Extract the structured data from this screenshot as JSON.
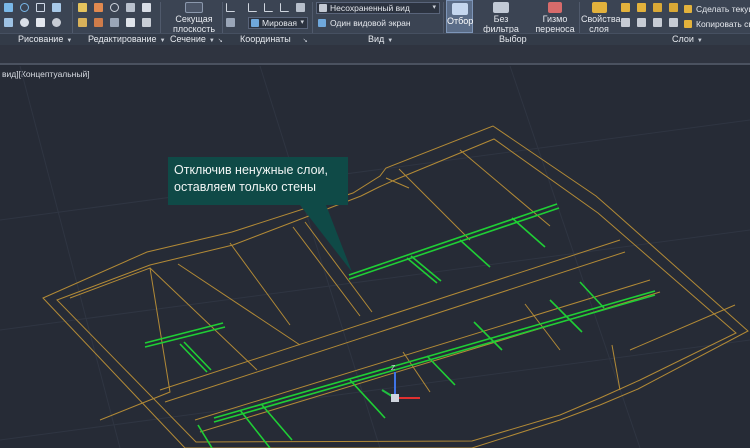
{
  "ribbon": {
    "groups": {
      "draw": "Рисование",
      "modify": "Редактирование",
      "section": "Сечение",
      "coordinates": "Координаты",
      "view": "Вид",
      "selection": "Выбор",
      "layers": "Слои"
    },
    "section_plane": {
      "line1": "Секущая",
      "line2": "плоскость"
    },
    "ucs_combo": "Мировая",
    "view_combo": "Несохраненный вид",
    "viewport_config": "Один видовой экран",
    "selection_btn": "Отбор",
    "no_filter": {
      "label": "Без фильтра",
      "arrow": "▾"
    },
    "gizmo": {
      "line1": "Гизмо",
      "line2": "переноса"
    },
    "layer_props": {
      "line1": "Свойства",
      "line2": "слоя"
    },
    "make_current": "Сделать текущим",
    "copy_props": "Копировать сво"
  },
  "viewport": {
    "label": "вид][Концептуальный]"
  },
  "callout": {
    "line1": "Отключив ненужные слои,",
    "line2": "оставляем только стены"
  },
  "colors": {
    "ribbon_bg": "#3b4453",
    "viewport_bg": "#262b36",
    "outline": "#b28a36",
    "walls": "#1fcf35",
    "callout_bg": "#0f4a47"
  }
}
